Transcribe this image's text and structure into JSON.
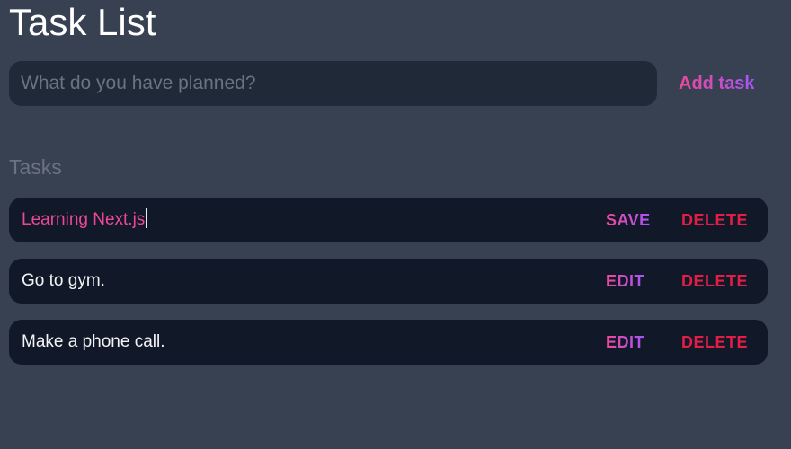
{
  "header": {
    "title": "Task List"
  },
  "new_task": {
    "placeholder": "What do you have planned?",
    "value": "",
    "add_label": "Add task"
  },
  "tasks_section": {
    "heading": "Tasks"
  },
  "tasks": [
    {
      "text": "Learning Next.js",
      "editing": true,
      "primary_label": "SAVE",
      "delete_label": "DELETE"
    },
    {
      "text": "Go to gym.",
      "editing": false,
      "primary_label": "EDIT",
      "delete_label": "DELETE"
    },
    {
      "text": "Make a phone call.",
      "editing": false,
      "primary_label": "EDIT",
      "delete_label": "DELETE"
    }
  ],
  "colors": {
    "background": "#374151",
    "input_background": "#1f2937",
    "row_background": "#111827",
    "accent_gradient_start": "#ec4899",
    "accent_gradient_end": "#a855f7",
    "delete": "#e11d48",
    "muted": "#6b7280"
  }
}
